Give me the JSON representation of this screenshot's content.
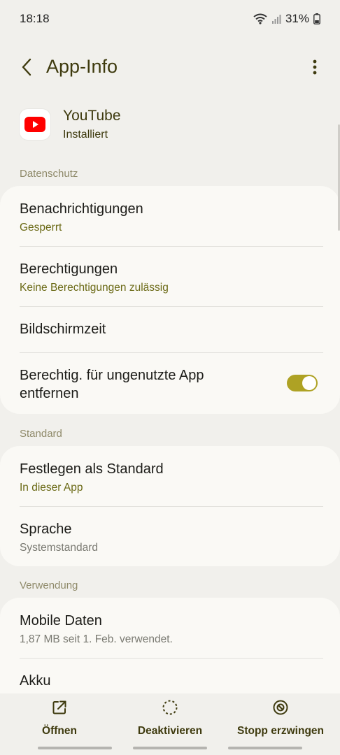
{
  "status_bar": {
    "time": "18:18",
    "battery": "31%",
    "icons": [
      "wifi-icon",
      "signal-icon",
      "battery-icon"
    ]
  },
  "header": {
    "title": "App-Info",
    "back_icon": "chevron-left-icon",
    "more_icon": "more-vertical-icon"
  },
  "app": {
    "name": "YouTube",
    "status": "Installiert",
    "icon": "youtube-icon"
  },
  "sections": {
    "privacy": {
      "label": "Datenschutz",
      "notifications": {
        "title": "Benachrichtigungen",
        "sub": "Gesperrt"
      },
      "permissions": {
        "title": "Berechtigungen",
        "sub": "Keine Berechtigungen zulässig"
      },
      "screen_time": {
        "title": "Bildschirmzeit"
      },
      "remove_permissions": {
        "title_line1": "Berechtig. für ungenutzte App",
        "title_line2": "entfernen",
        "enabled": true
      }
    },
    "standard": {
      "label": "Standard",
      "set_default": {
        "title": "Festlegen als Standard",
        "sub": "In dieser App"
      },
      "language": {
        "title": "Sprache",
        "sub": "Systemstandard"
      }
    },
    "usage": {
      "label": "Verwendung",
      "mobile_data": {
        "title": "Mobile Daten",
        "sub": "1,87 MB seit 1. Feb. verwendet."
      },
      "battery": {
        "title": "Akku"
      }
    }
  },
  "bottom_bar": {
    "open": {
      "label": "Öffnen",
      "icon": "open-external-icon"
    },
    "disable": {
      "label": "Deaktivieren",
      "icon": "disable-icon"
    },
    "force_stop": {
      "label": "Stopp erzwingen",
      "icon": "force-stop-icon"
    }
  },
  "colors": {
    "background": "#f1f0ec",
    "card": "#faf9f5",
    "accent_olive": "#6b6a16",
    "title_olive": "#3e3a0e",
    "toggle_on": "#aea224",
    "youtube_red": "#ff0000"
  }
}
